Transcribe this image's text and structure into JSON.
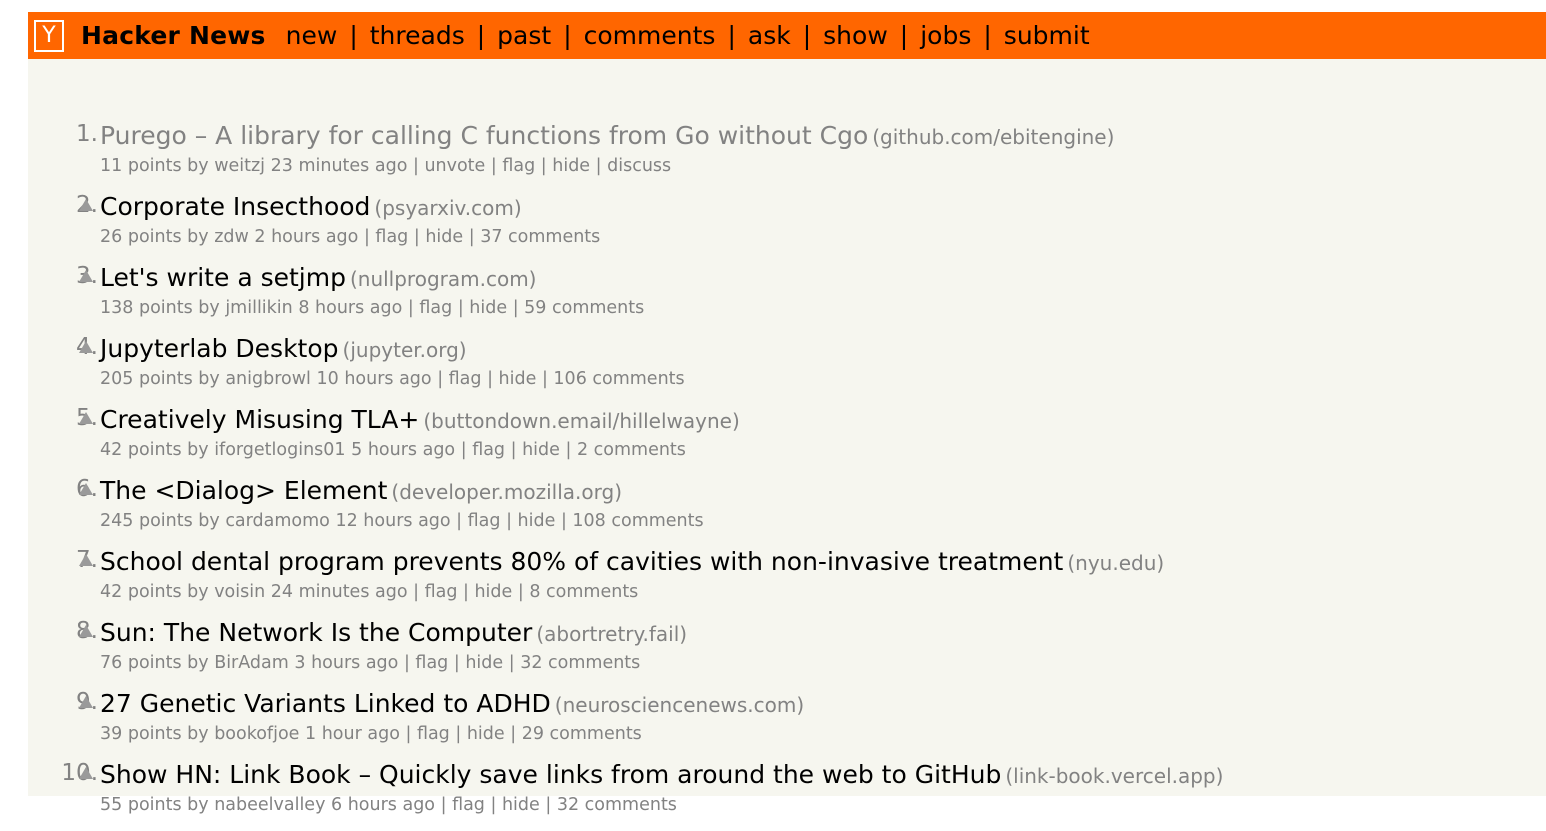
{
  "header": {
    "logo": "Y",
    "site_name": "Hacker News",
    "nav": [
      "new",
      "threads",
      "past",
      "comments",
      "ask",
      "show",
      "jobs",
      "submit"
    ],
    "separator": "|"
  },
  "colors": {
    "accent": "#ff6600",
    "background": "#f6f6ef",
    "muted": "#828282"
  },
  "stories": [
    {
      "rank": "1.",
      "title": "Purego – A library for calling C functions from Go without Cgo",
      "site": "(github.com/ebitengine)",
      "points": "11 points",
      "user": "weitzj",
      "age": "23 minutes ago",
      "actions": [
        "unvote",
        "flag",
        "hide",
        "discuss"
      ],
      "voted": true
    },
    {
      "rank": "2.",
      "title": "Corporate Insecthood",
      "site": "(psyarxiv.com)",
      "points": "26 points",
      "user": "zdw",
      "age": "2 hours ago",
      "actions": [
        "flag",
        "hide",
        "37 comments"
      ],
      "voted": false
    },
    {
      "rank": "3.",
      "title": "Let's write a setjmp",
      "site": "(nullprogram.com)",
      "points": "138 points",
      "user": "jmillikin",
      "age": "8 hours ago",
      "actions": [
        "flag",
        "hide",
        "59 comments"
      ],
      "voted": false
    },
    {
      "rank": "4.",
      "title": "Jupyterlab Desktop",
      "site": "(jupyter.org)",
      "points": "205 points",
      "user": "anigbrowl",
      "age": "10 hours ago",
      "actions": [
        "flag",
        "hide",
        "106 comments"
      ],
      "voted": false
    },
    {
      "rank": "5.",
      "title": "Creatively Misusing TLA+",
      "site": "(buttondown.email/hillelwayne)",
      "points": "42 points",
      "user": "iforgetlogins01",
      "age": "5 hours ago",
      "actions": [
        "flag",
        "hide",
        "2 comments"
      ],
      "voted": false
    },
    {
      "rank": "6.",
      "title": "The <Dialog> Element",
      "site": "(developer.mozilla.org)",
      "points": "245 points",
      "user": "cardamomo",
      "age": "12 hours ago",
      "actions": [
        "flag",
        "hide",
        "108 comments"
      ],
      "voted": false
    },
    {
      "rank": "7.",
      "title": "School dental program prevents 80% of cavities with non-invasive treatment",
      "site": "(nyu.edu)",
      "points": "42 points",
      "user": "voisin",
      "age": "24 minutes ago",
      "actions": [
        "flag",
        "hide",
        "8 comments"
      ],
      "voted": false
    },
    {
      "rank": "8.",
      "title": "Sun: The Network Is the Computer",
      "site": "(abortretry.fail)",
      "points": "76 points",
      "user": "BirAdam",
      "age": "3 hours ago",
      "actions": [
        "flag",
        "hide",
        "32 comments"
      ],
      "voted": false
    },
    {
      "rank": "9.",
      "title": "27 Genetic Variants Linked to ADHD",
      "site": "(neurosciencenews.com)",
      "points": "39 points",
      "user": "bookofjoe",
      "age": "1 hour ago",
      "actions": [
        "flag",
        "hide",
        "29 comments"
      ],
      "voted": false
    },
    {
      "rank": "10.",
      "title": "Show HN: Link Book – Quickly save links from around the web to GitHub",
      "site": "(link-book.vercel.app)",
      "points": "55 points",
      "user": "nabeelvalley",
      "age": "6 hours ago",
      "actions": [
        "flag",
        "hide",
        "32 comments"
      ],
      "voted": false
    }
  ]
}
